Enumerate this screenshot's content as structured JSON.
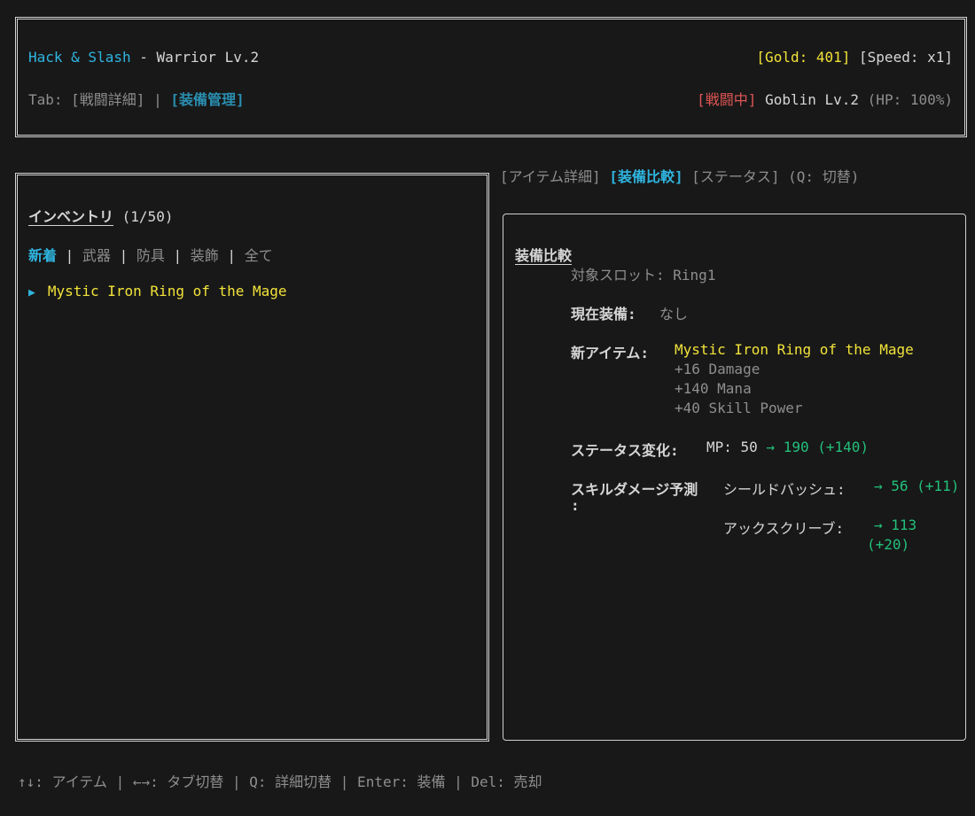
{
  "header": {
    "game_title": "Hack & Slash",
    "separator": " - ",
    "player": "Warrior Lv.2",
    "gold": "[Gold: 401]",
    "speed": "[Speed: x1]",
    "tab_prefix": "Tab: ",
    "tab_battle": "[戦闘詳細]",
    "tab_sep": " | ",
    "tab_equip": "[装備管理]",
    "battle_status": "[戦闘中]",
    "enemy": "Goblin Lv.2",
    "enemy_hp": "(HP: 100%)"
  },
  "inventory": {
    "title": "インベントリ",
    "count": "(1/50)",
    "filters": [
      "新着",
      "武器",
      "防具",
      "装飾",
      "全て"
    ],
    "filter_sep": " | ",
    "items": [
      {
        "cursor": "▶",
        "name": "Mystic Iron Ring of the Mage"
      }
    ]
  },
  "detail_tabs": {
    "item_detail": "[アイテム詳細]",
    "compare": "[装備比較]",
    "status": "[ステータス]",
    "hint": "(Q: 切替)"
  },
  "compare": {
    "title": "装備比較",
    "slot_label": "対象スロット: ",
    "slot_value": "Ring1",
    "current_label": "現在装備:",
    "current_value": "なし",
    "new_label": "新アイテム:",
    "new_name": "Mystic Iron Ring of the Mage",
    "new_stats": [
      "+16 Damage",
      "+140 Mana",
      "+40 Skill Power"
    ],
    "status_change_label": "ステータス変化:",
    "mp_label": "MP: 50",
    "mp_change": " → 190 (+140)",
    "skill_label": "スキルダメージ予測",
    "skill_label_colon": ":",
    "skills": [
      {
        "name": "シールドバッシュ:",
        "value": "→ 56 (+11)"
      },
      {
        "name": "アックスクリーブ:",
        "value": "→ 113",
        "value_cont": "(+20)"
      }
    ]
  },
  "footer": {
    "hints": "↑↓: アイテム | ←→: タブ切替 | Q: 詳細切替 | Enter: 装備 | Del: 売却"
  },
  "colors": {
    "background": "#181818",
    "accent": "#2fb5e0",
    "item": "#f2e33a",
    "battle": "#e05555",
    "positive": "#22c07a"
  }
}
